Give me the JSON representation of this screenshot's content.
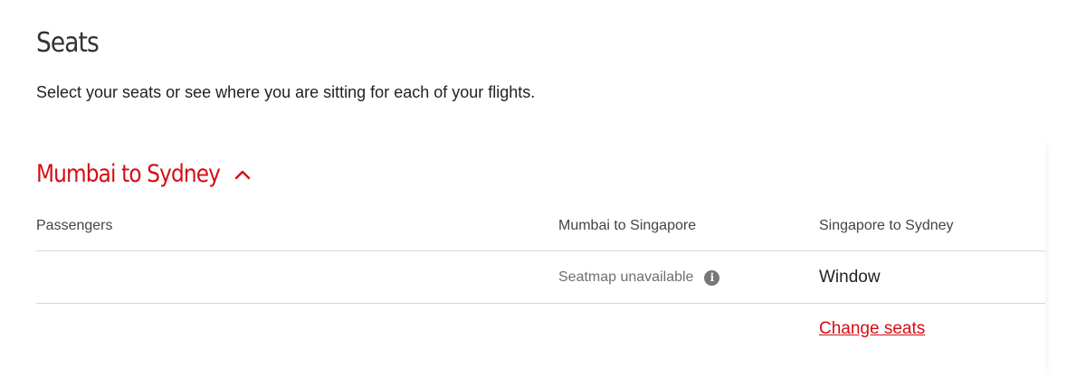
{
  "page": {
    "title": "Seats",
    "subtitle": "Select your seats or see where you are sitting for each of your flights."
  },
  "trip": {
    "route_title": "Mumbai to Sydney",
    "expanded": true,
    "columns": {
      "passengers": "Passengers",
      "leg1": "Mumbai to Singapore",
      "leg2": "Singapore to Sydney"
    },
    "row": {
      "passenger_name": "",
      "leg1_status": "Seatmap unavailable",
      "leg2_seat": "Window"
    },
    "change_seats_label": "Change seats"
  },
  "icons": {
    "collapse": "chevron-up-icon",
    "info": "info-icon"
  },
  "colors": {
    "accent": "#d40e14",
    "text": "#222222",
    "muted": "#707070",
    "divider": "#d8d8d8"
  }
}
